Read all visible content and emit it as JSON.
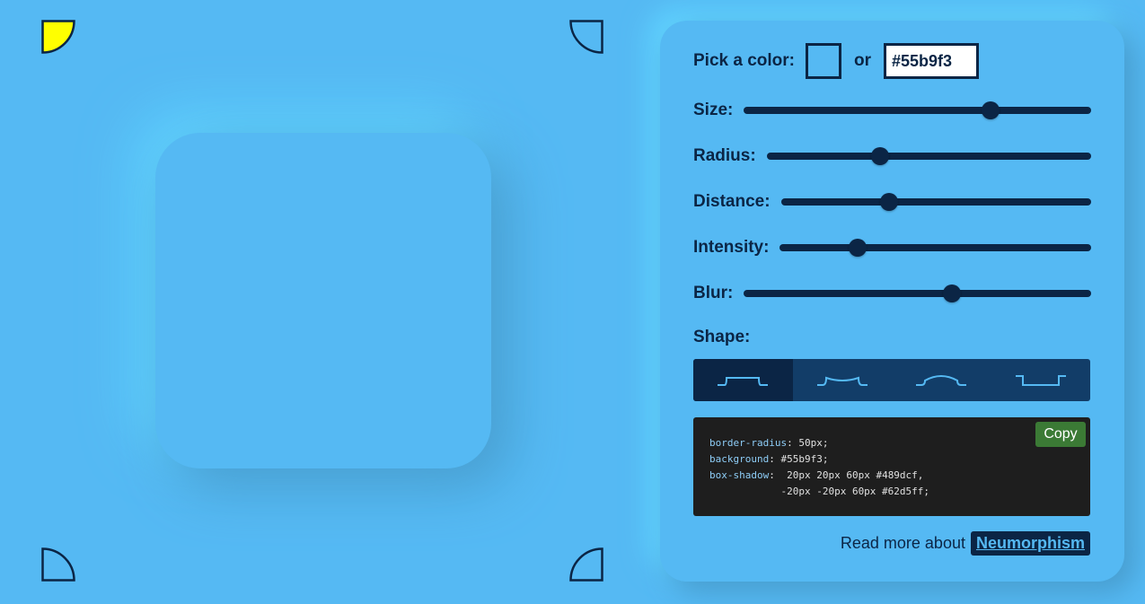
{
  "colors": {
    "background": "#55b9f3",
    "dark": "#0b2545",
    "highlight_corner": "#ffff00",
    "copy_button": "#3b7a35"
  },
  "corners": [
    {
      "name": "corner-top-left",
      "icon": "quarter-circle-icon",
      "active": true
    },
    {
      "name": "corner-top-right",
      "icon": "quarter-circle-icon",
      "active": false
    },
    {
      "name": "corner-bottom-left",
      "icon": "quarter-circle-icon",
      "active": false
    },
    {
      "name": "corner-bottom-right",
      "icon": "quarter-circle-icon",
      "active": false
    }
  ],
  "panel": {
    "pick_color_label": "Pick a color:",
    "or_label": "or",
    "hex_value": "#55b9f3",
    "sliders": [
      {
        "label": "Size:",
        "value_fraction": 0.71
      },
      {
        "label": "Radius:",
        "value_fraction": 0.35
      },
      {
        "label": "Distance:",
        "value_fraction": 0.35
      },
      {
        "label": "Intensity:",
        "value_fraction": 0.25
      },
      {
        "label": "Blur:",
        "value_fraction": 0.6
      }
    ],
    "shape_label": "Shape:",
    "shapes": [
      {
        "name": "flat",
        "icon": "shape-flat-icon",
        "active": true
      },
      {
        "name": "concave",
        "icon": "shape-concave-icon",
        "active": false
      },
      {
        "name": "convex",
        "icon": "shape-convex-icon",
        "active": false
      },
      {
        "name": "pressed",
        "icon": "shape-pressed-icon",
        "active": false
      }
    ],
    "code": {
      "line1_prop": "border-radius",
      "line1_val": " 50px;",
      "line2_prop": "background",
      "line2_val": " #55b9f3;",
      "line3_prop": "box-shadow",
      "line3_val": "  20px 20px 60px #489dcf,",
      "line4_val": "            -20px -20px 60px #62d5ff;"
    },
    "copy_label": "Copy",
    "footer_text": "Read more about",
    "footer_link": "Neumorphism"
  }
}
